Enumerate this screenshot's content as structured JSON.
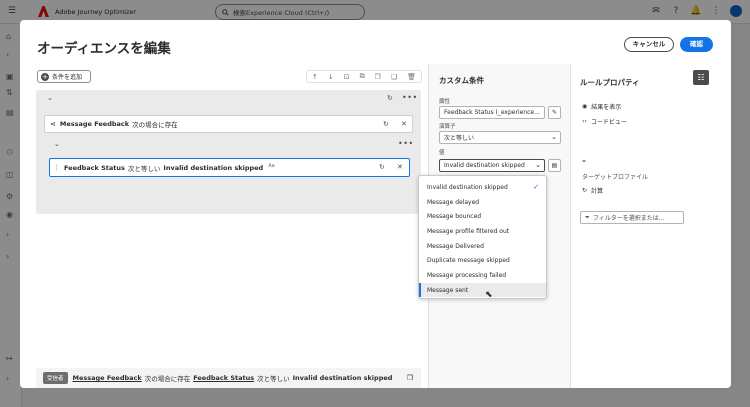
{
  "app": {
    "name": "Adobe Journey Optimizer",
    "search_placeholder": "検索Experience Cloud (Ctrl+/)"
  },
  "dialog": {
    "title": "オーディエンスを編集",
    "cancel_label": "キャンセル",
    "confirm_label": "確認",
    "add_condition_label": "条件を追加",
    "rule1": {
      "bold": "Message Feedback",
      "text": "次の場合に存在"
    },
    "rule2": {
      "field": "Feedback Status",
      "op": "次と等しい",
      "value": "Invalid destination skipped",
      "badge": "Aa"
    },
    "summary": {
      "badge": "受信者",
      "part1": "Message Feedback",
      "part2": "次の場合に存在",
      "part3": "Feedback Status",
      "part4": "次と等しい",
      "part5": "Invalid destination skipped"
    }
  },
  "custom_condition": {
    "title": "カスタム条件",
    "attribute_label": "属性",
    "attribute_value": "Feedback Status (_experience...",
    "operator_label": "演算子",
    "operator_value": "次と等しい",
    "value_label": "値",
    "value_value": "Invalid destination skipped",
    "options": [
      "Invalid destination skipped",
      "Message delayed",
      "Message bounced",
      "Message profile filtered out",
      "Message Delivered",
      "Duplicate message skipped",
      "Message processing failed",
      "Message sent"
    ],
    "selected_option": "Invalid destination skipped",
    "hovered_option": "Message sent"
  },
  "rule_properties": {
    "title": "ルールプロパティ",
    "show_results": "結果を表示",
    "code_view": "コードビュー",
    "dash": "–",
    "target_profile_label": "ターゲットプロファイル",
    "calculate": "計算",
    "filter_placeholder": "フィルターを選択または..."
  }
}
